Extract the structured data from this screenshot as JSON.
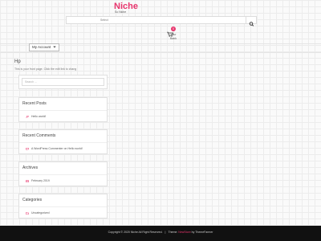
{
  "site": {
    "title": "Niche",
    "tagline": "So Niche"
  },
  "search": {
    "placeholder": "",
    "category_label": "Select"
  },
  "cart": {
    "count": "0",
    "label_line1": "Your",
    "label_line2": "Bank"
  },
  "account": {
    "label": "My Account"
  },
  "page": {
    "title": "Hp",
    "intro": "This is your front page. Click the edit link to chang"
  },
  "sidebar": {
    "search_placeholder": "Search ...",
    "recent_posts": {
      "title": "Recent Posts",
      "items": [
        "Hello world!"
      ]
    },
    "recent_comments": {
      "title": "Recent Comments",
      "items": [
        "A WordPress Commenter on Hello world!"
      ]
    },
    "archives": {
      "title": "Archives",
      "items": [
        "February 2019"
      ]
    },
    "categories": {
      "title": "Categories",
      "items": [
        "Uncategorized"
      ]
    }
  },
  "footer": {
    "copyright": "Copyright © 2020 Niche All Right Reserved.",
    "separator": "|",
    "theme_label": "Theme:",
    "theme_name": "NewStore",
    "by_text": "by ThemeFarmer"
  },
  "colors": {
    "accent": "#e8356d",
    "footer_bg": "#111111"
  },
  "icons": [
    "search-icon",
    "cart-icon",
    "chevron-down-icon",
    "pushpin-icon",
    "comment-icon",
    "calendar-icon",
    "folder-icon"
  ]
}
